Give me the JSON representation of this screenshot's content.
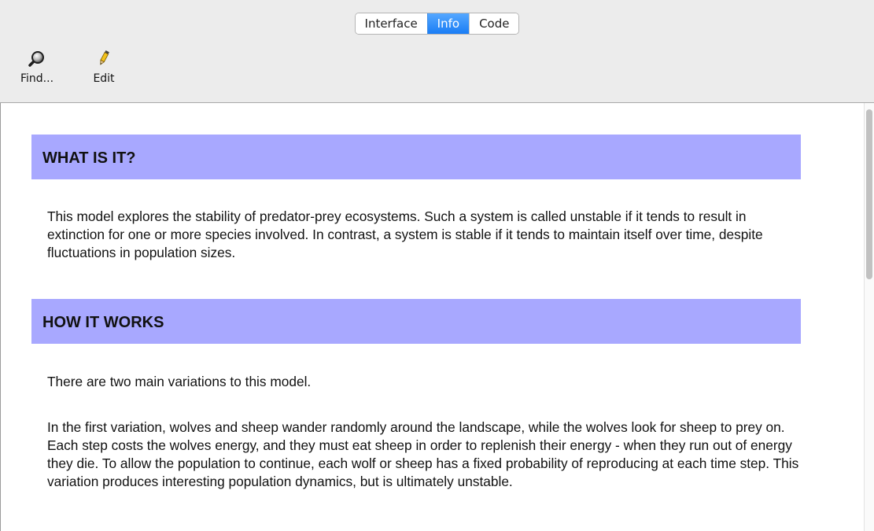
{
  "tabs": {
    "interface": "Interface",
    "info": "Info",
    "code": "Code",
    "active": "Info"
  },
  "toolbar": {
    "find": {
      "label": "Find...",
      "icon": "magnifier-icon"
    },
    "edit": {
      "label": "Edit",
      "icon": "pencil-icon"
    }
  },
  "info": {
    "sections": [
      {
        "heading": "WHAT IS IT?",
        "paragraphs": [
          "This model explores the stability of predator-prey ecosystems. Such a system is called unstable if it tends to result in extinction for one or more species involved. In contrast, a system is stable if it tends to maintain itself over time, despite fluctuations in population sizes."
        ]
      },
      {
        "heading": "HOW IT WORKS",
        "paragraphs": [
          "There are two main variations to this model.",
          "In the first variation, wolves and sheep wander randomly around the landscape, while the wolves look for sheep to prey on. Each step costs the wolves energy, and they must eat sheep in order to replenish their energy - when they run out of energy they die. To allow the population to continue, each wolf or sheep has a fixed probability of reproducing at each time step. This variation produces interesting population dynamics, but is ultimately unstable."
        ]
      }
    ]
  },
  "colors": {
    "section_header_bg": "#a8a8ff",
    "active_tab": "#1a7df5"
  }
}
